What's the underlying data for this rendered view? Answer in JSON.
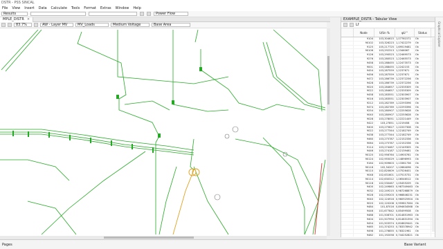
{
  "window": {
    "title": "DSTR - PSS SINCAL"
  },
  "menu": [
    "File",
    "View",
    "Insert",
    "Data",
    "Calculate",
    "Tools",
    "Format",
    "Extras",
    "Window",
    "Help"
  ],
  "toolbar1": {
    "results_label": "Results",
    "mode_label": "Power Flow"
  },
  "network_tab": {
    "label": "MPLE_DISTR"
  },
  "toolbar2": {
    "zoom": "83.7%",
    "layer": "AW - Layer MV",
    "filter": "MV_Loads",
    "voltage": "Medium Voltage",
    "area": "Base Area"
  },
  "table_panel": {
    "tab_label": "EXAMPLE_DISTR - Tabular View",
    "lf_label": "Lf",
    "columns": [
      "Node",
      "U/Un %",
      "φU °",
      "Status"
    ],
    "rows": [
      [
        "9104",
        "103,304615",
        "1,07761571",
        "Ok"
      ],
      [
        "90102",
        "103,326223",
        "1,17422279",
        "Ok"
      ],
      [
        "9125",
        "105,217725",
        "1,69519461",
        "Ok"
      ],
      [
        "90106",
        "103,292313",
        "1,2346067",
        "Ok"
      ],
      [
        "9126",
        "103,290523",
        "1,22469573",
        "Ok"
      ],
      [
        "9276",
        "103,280523",
        "1,22465573",
        "Ok"
      ],
      [
        "9458",
        "103,288455",
        "1,22473573",
        "Ok"
      ],
      [
        "9001",
        "103,288455",
        "1,2242153",
        "Ok"
      ],
      [
        "9454",
        "103,287559",
        "1,2237671",
        "Ok"
      ],
      [
        "9456",
        "103,287559",
        "1,2237671",
        "Ok"
      ],
      [
        "9472",
        "103,286739",
        "1,22372256",
        "Ok"
      ],
      [
        "9428",
        "103,286739",
        "1,22372256",
        "Ok"
      ],
      [
        "9020",
        "103,284657",
        "1,22335309",
        "Ok"
      ],
      [
        "9022",
        "103,284657",
        "1,22335309",
        "Ok"
      ],
      [
        "9458",
        "103,283551",
        "1,22303907",
        "Ok"
      ],
      [
        "9016",
        "103,283551",
        "1,22303907",
        "Ok"
      ],
      [
        "9212",
        "103,282789",
        "1,22293396",
        "Ok"
      ],
      [
        "9474",
        "103,282789",
        "1,22293396",
        "Ok"
      ],
      [
        "9254",
        "103,280907",
        "1,22255628",
        "Ok"
      ],
      [
        "9040",
        "103,280907",
        "1,22255628",
        "Ok"
      ],
      [
        "9028",
        "103,278051",
        "1,22221449",
        "Ok"
      ],
      [
        "9422",
        "103,27851",
        "1,2219458",
        "Ok"
      ],
      [
        "9400",
        "103,275627",
        "1,22207308",
        "Ok"
      ],
      [
        "9022",
        "103,277344",
        "1,22182749",
        "Ok"
      ],
      [
        "9438",
        "103,277344",
        "1,22182749",
        "Ok"
      ],
      [
        "9460",
        "103,275787",
        "1,22152336",
        "Ok"
      ],
      [
        "9064",
        "103,275787",
        "1,22152336",
        "Ok"
      ],
      [
        "9114",
        "103,274467",
        "1,22149305",
        "Ok"
      ],
      [
        "9446",
        "103,274187",
        "1,22139461",
        "Ok"
      ],
      [
        "90120",
        "102,956764",
        "1,14900761",
        "Ok"
      ],
      [
        "90124",
        "102,955029",
        "1,14896993",
        "Ok"
      ],
      [
        "9164",
        "102,909603",
        "1,13361736",
        "Ok"
      ],
      [
        "90116",
        "102,54207",
        "1,12664096",
        "Ok"
      ],
      [
        "90110",
        "102,820609",
        "1,07526401",
        "Ok"
      ],
      [
        "9048",
        "102,631601",
        "1,07515731",
        "Ok"
      ],
      [
        "90114",
        "102,630312",
        "1,06546512",
        "Ok"
      ],
      [
        "90118",
        "102,530467",
        "1,05455209",
        "Ok"
      ],
      [
        "9400",
        "102,249863",
        "0,987349463",
        "Ok"
      ],
      [
        "9032",
        "102,249215",
        "0,987268879",
        "Ok"
      ],
      [
        "9028",
        "102,039203",
        "0,966846231",
        "Ok"
      ],
      [
        "9040",
        "102,124916",
        "0,960925904",
        "Ok"
      ],
      [
        "9020",
        "102,120208",
        "0,959817064",
        "Ok"
      ],
      [
        "9484",
        "101,87016",
        "0,894634568",
        "Ok"
      ],
      [
        "9446",
        "101,677842",
        "0,85499508",
        "Ok"
      ],
      [
        "9488",
        "101,508701",
        "0,814851963",
        "Ok"
      ],
      [
        "9404",
        "101,507994",
        "0,814831394",
        "Ok"
      ],
      [
        "9454",
        "101,503374",
        "0,818629441",
        "Ok"
      ],
      [
        "9465",
        "101,374253",
        "0,783378942",
        "Ok"
      ],
      [
        "9498",
        "101,276855",
        "0,78321961",
        "Ok"
      ],
      [
        "9482",
        "101,192058",
        "0,744252821",
        "Ok"
      ]
    ]
  },
  "side_panel": {
    "label": "Graphical Explorer"
  },
  "status": {
    "left_text": "Pages",
    "right_text": "Base Variant"
  },
  "colors": {
    "network": "#22aa22",
    "feeder_red": "#d83030",
    "feeder_orange": "#e0a020"
  }
}
